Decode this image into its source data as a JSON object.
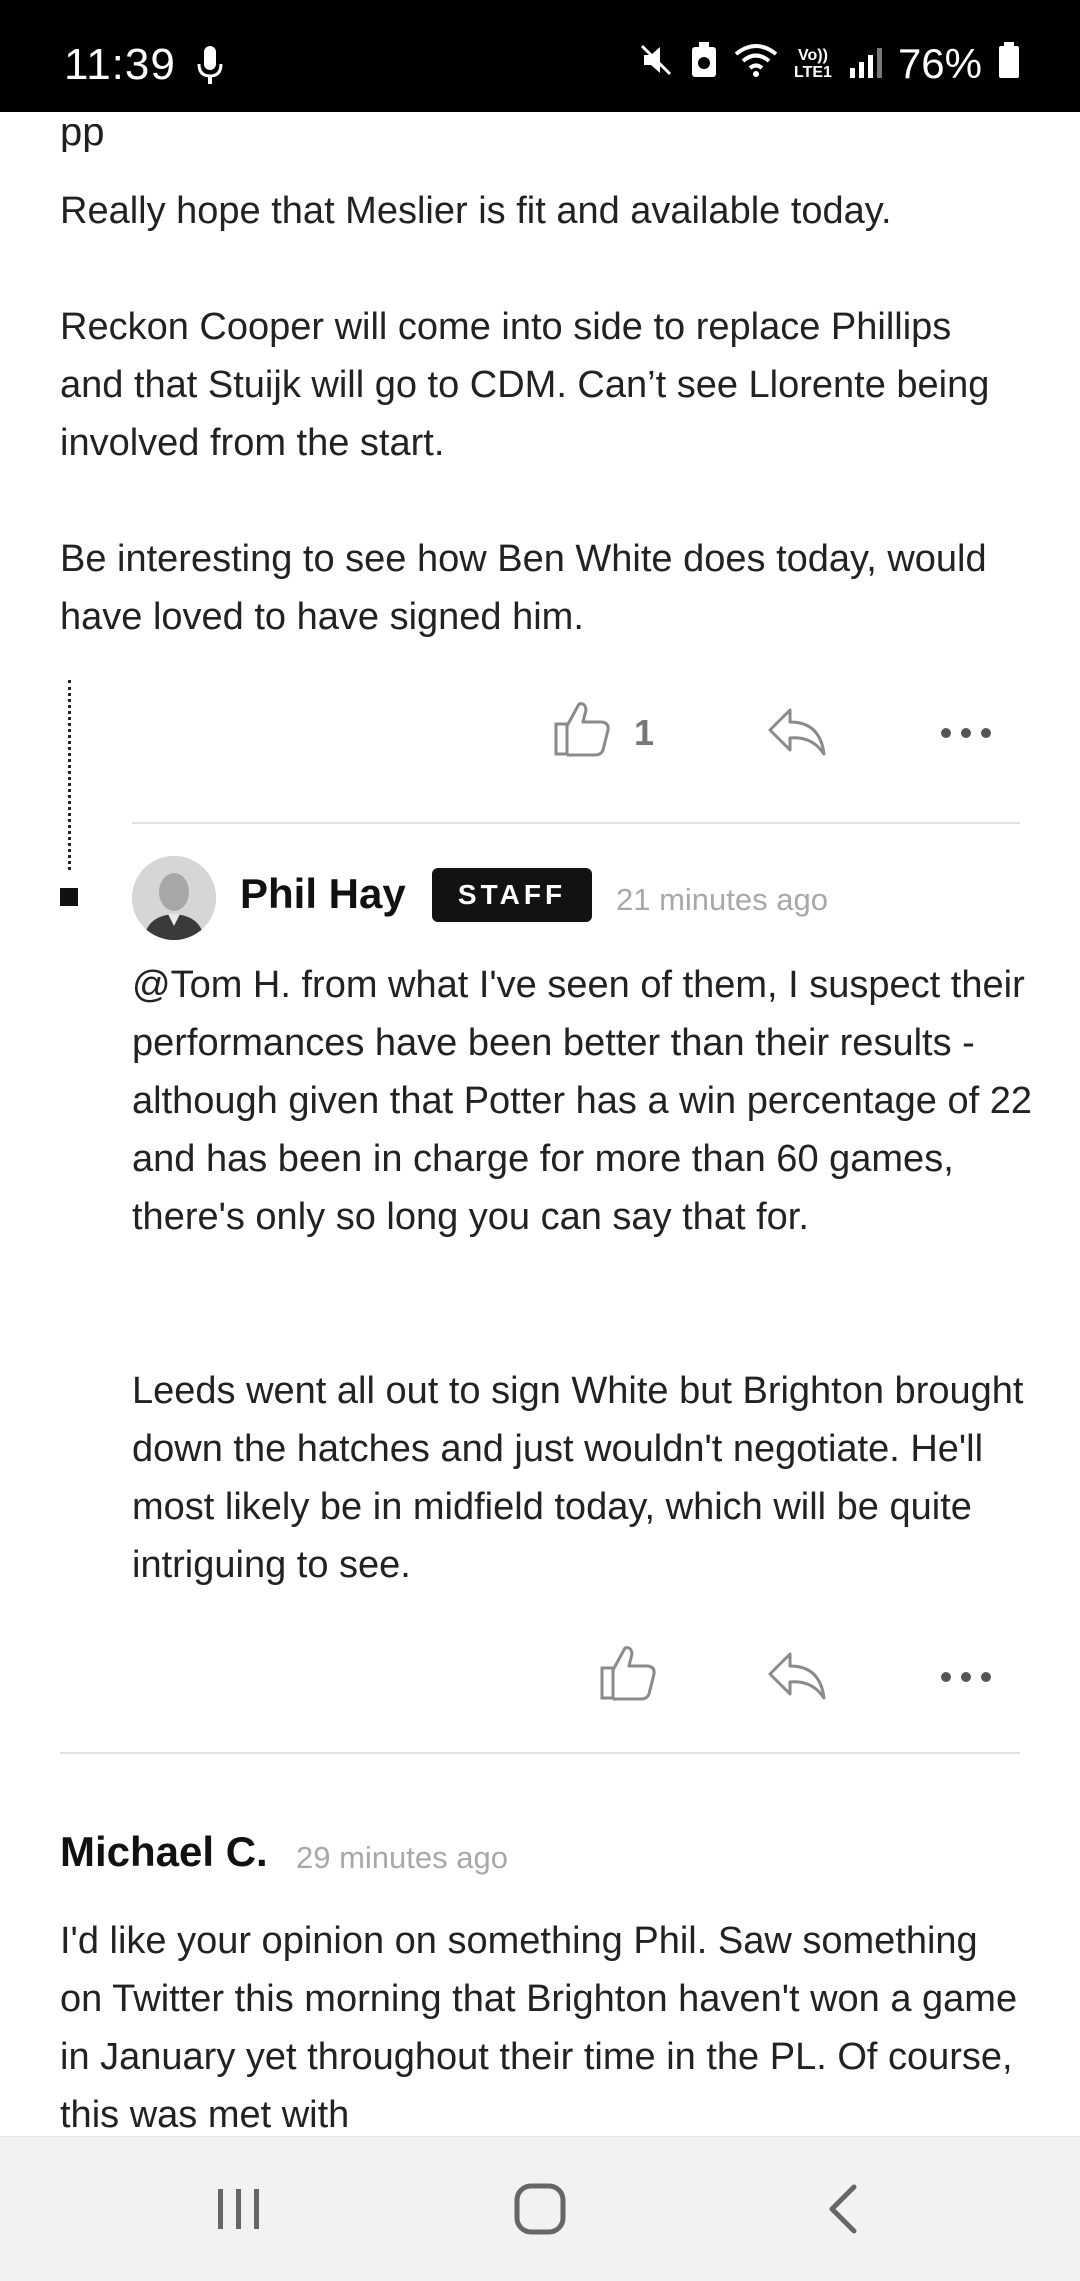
{
  "status_bar": {
    "time": "11:39",
    "network_label_top": "Vo))",
    "network_label_bottom": "LTE1",
    "battery": "76%"
  },
  "comment_top": {
    "paragraphs": [
      "Really hope that Meslier is fit and available today.",
      "Reckon Cooper will come into side to replace Phillips and that Stuijk will go to CDM. Can’t see Llorente being involved from the start.",
      "Be interesting to see how Ben White does today, would have loved to have signed him."
    ],
    "like_count": "1"
  },
  "reply": {
    "author": "Phil Hay",
    "badge": "STAFF",
    "timestamp": "21 minutes ago",
    "paragraphs": [
      "@Tom H. from what I've seen of them, I suspect their performances have been better than their results - although given that Potter has a win percentage of 22 and has been in charge for more than 60 games, there's only so long you can say that for.",
      "Leeds went all out to sign White but Brighton brought down the hatches and just wouldn't negotiate. He'll most likely be in midfield today, which will be quite intriguing to see."
    ]
  },
  "comment_next": {
    "author": "Michael C.",
    "timestamp": "29 minutes ago",
    "text": "I'd like your opinion on something Phil. Saw something on Twitter this morning that Brighton haven't won a game in January yet throughout their time in the PL. Of course, this was met with"
  },
  "icons": {
    "like": "thumbs-up-icon",
    "reply": "reply-arrow-icon",
    "more": "more-dots-icon",
    "nav_recent": "recent-apps-icon",
    "nav_home": "home-icon",
    "nav_back": "back-icon"
  }
}
